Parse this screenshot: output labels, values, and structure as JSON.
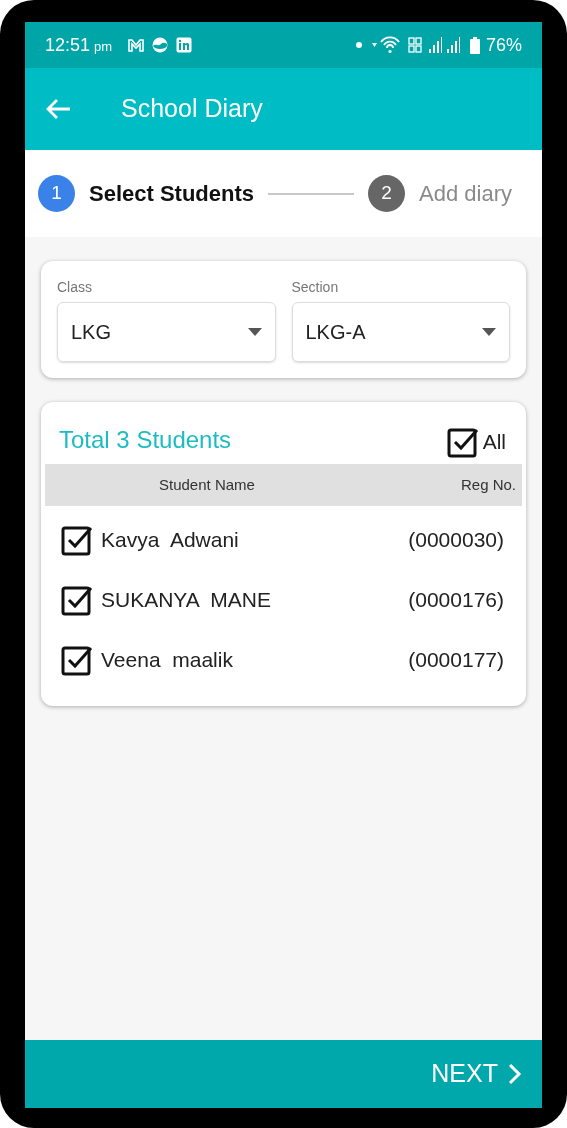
{
  "status_bar": {
    "time": "12:51",
    "time_suffix": "pm",
    "battery": "76%"
  },
  "app_bar": {
    "title": "School Diary"
  },
  "steps": [
    {
      "number": "1",
      "label": "Select Students",
      "active": true
    },
    {
      "number": "2",
      "label": "Add diary",
      "active": false
    }
  ],
  "filters": [
    {
      "label": "Class",
      "value": "LKG"
    },
    {
      "label": "Section",
      "value": "LKG-A"
    }
  ],
  "students_panel": {
    "title": "Total 3 Students",
    "select_all": {
      "label": "All",
      "checked": true
    },
    "columns": [
      "Student Name",
      "Reg No."
    ],
    "rows": [
      {
        "name": "Kavya  Adwani",
        "reg_no": "(0000030)",
        "checked": true
      },
      {
        "name": "SUKANYA  MANE",
        "reg_no": "(0000176)",
        "checked": true
      },
      {
        "name": "Veena  maalik",
        "reg_no": "(0000177)",
        "checked": true
      }
    ]
  },
  "footer": {
    "next_label": "NEXT"
  }
}
